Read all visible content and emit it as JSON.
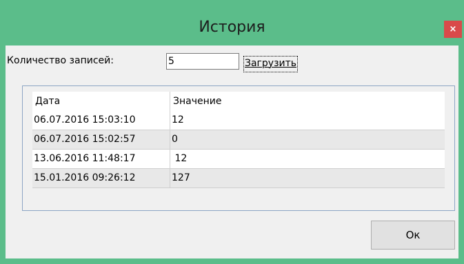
{
  "window": {
    "title": "История",
    "close_label": "×"
  },
  "form": {
    "count_label": "Количество записей:",
    "count_value": "5",
    "load_label": "Загрузить"
  },
  "grid": {
    "columns": [
      "Дата",
      "Значение"
    ],
    "rows": [
      {
        "date": "06.07.2016 15:03:10",
        "value": "12"
      },
      {
        "date": "06.07.2016 15:02:57",
        "value": "0"
      },
      {
        "date": "13.06.2016 11:48:17",
        "value": " 12"
      },
      {
        "date": "15.01.2016 09:26:12",
        "value": "127"
      }
    ]
  },
  "footer": {
    "ok_label": "Ок"
  },
  "colors": {
    "titlebar": "#5bbd8a",
    "close_button": "#d94a4a"
  }
}
